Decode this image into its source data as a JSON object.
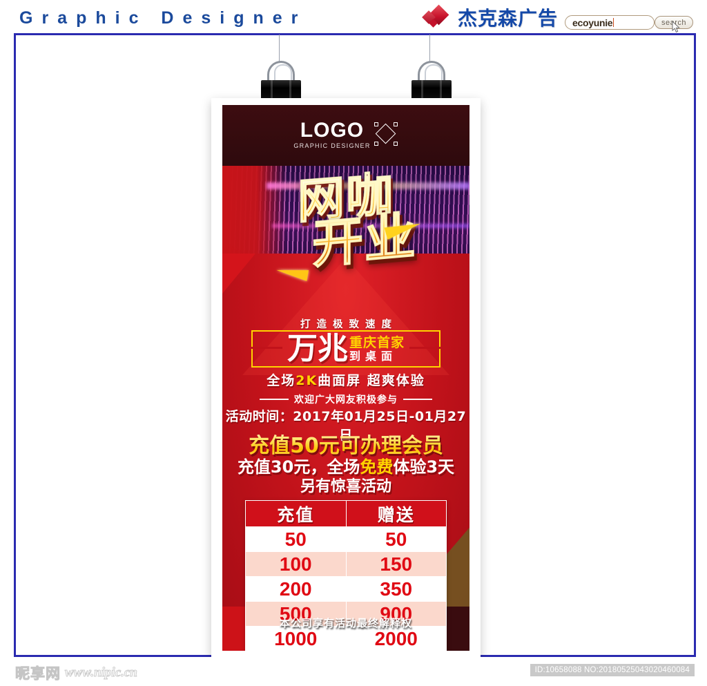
{
  "header": {
    "brand_en": "Graphic Designer",
    "brand_cn": "杰克森广告",
    "diamond_icon": "diamond-logo-icon",
    "search": {
      "value": "ecoyunie",
      "placeholder": "ecoyunie",
      "button_label": "search"
    }
  },
  "poster": {
    "logo": {
      "main": "LOGO",
      "sub": "GRAPHIC DESIGNER",
      "mark_icon": "diamond-outline-icon"
    },
    "title": {
      "line1": "网咖",
      "line2": "开业"
    },
    "sub_slogan": "打造极致速度",
    "highlight": {
      "big": "万兆",
      "yellow": "重庆首家",
      "white": "到桌面"
    },
    "feature": {
      "part1": "全场",
      "key": "2K",
      "part2": "曲面屏  超爽体验"
    },
    "welcome": "欢迎广大网友积极参与",
    "date": "活动时间：2017年01月25日-01月27日",
    "promo1": "充值50元可办理会员",
    "promo2": {
      "part1": "充值30元，全场",
      "key": "免费",
      "part2": "体验3天"
    },
    "promo3": "另有惊喜活动",
    "table": {
      "headers": [
        "充值",
        "赠送"
      ],
      "rows": [
        [
          "50",
          "50"
        ],
        [
          "100",
          "150"
        ],
        [
          "200",
          "350"
        ],
        [
          "500",
          "900"
        ],
        [
          "1000",
          "2000"
        ]
      ]
    },
    "disclaimer": "本公司享有活动最终解释权"
  },
  "footer": {
    "watermark_cn": "昵享网",
    "watermark_url": "www.nipic.cn",
    "id_label": "ID:10658088 NO:20180525043020460084"
  },
  "colors": {
    "brand_blue": "#1b4a9c",
    "frame_blue": "#2a2ab0",
    "poster_red": "#c1121a",
    "gold": "#ffd400",
    "table_red": "#e00a14"
  }
}
